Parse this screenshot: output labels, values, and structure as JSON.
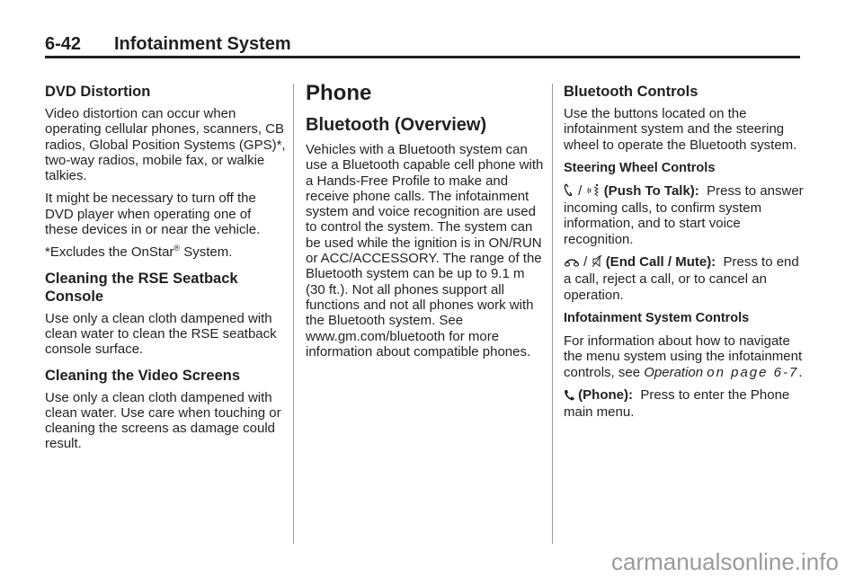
{
  "header": {
    "page_number": "6-42",
    "title": "Infotainment System"
  },
  "col1": {
    "dvd_heading": "DVD Distortion",
    "dvd_p1": "Video distortion can occur when operating cellular phones, scanners, CB radios, Global Position Systems (GPS)*, two-way radios, mobile fax, or walkie talkies.",
    "dvd_p2": "It might be necessary to turn off the DVD player when operating one of these devices in or near the vehicle.",
    "excl_prefix": "*Excludes the OnStar",
    "excl_reg": "®",
    "excl_suffix": " System.",
    "rse_heading": "Cleaning the RSE Seatback Console",
    "rse_p": "Use only a clean cloth dampened with clean water to clean the RSE seatback console surface.",
    "video_heading": "Cleaning the Video Screens",
    "video_p": "Use only a clean cloth dampened with clean water. Use care when touching or cleaning the screens as damage could result."
  },
  "col2": {
    "phone_heading": "Phone",
    "bt_heading": "Bluetooth (Overview)",
    "bt_p": "Vehicles with a Bluetooth system can use a Bluetooth capable cell phone with a Hands-Free Profile to make and receive phone calls. The infotainment system and voice recognition are used to control the system. The system can be used while the ignition is in ON/RUN or ACC/ACCESSORY. The range of the Bluetooth system can be up to 9.1 m (30 ft.). Not all phones support all functions and not all phones work with the Bluetooth system. See www.gm.com/bluetooth for more information about compatible phones."
  },
  "col3": {
    "btc_heading": "Bluetooth Controls",
    "btc_p": "Use the buttons located on the infotainment system and the steering wheel to operate the Bluetooth system.",
    "swc_heading": "Steering Wheel Controls",
    "ptt_sep": " / ",
    "ptt_label": "(Push To Talk):",
    "ptt_text": "  Press to answer incoming calls, to confirm system information, and to start voice recognition.",
    "end_sep": " / ",
    "end_label": "(End Call / Mute):",
    "end_text": "  Press to end a call, reject a call, or to cancel an operation.",
    "isc_heading": "Infotainment System Controls",
    "isc_p": "For information about how to navigate the menu system using the infotainment controls, see ",
    "isc_ref": "Operation",
    "isc_ref2": "on page 6-7",
    "isc_end": ".",
    "phone_label": "(Phone):",
    "phone_text": "  Press to enter the Phone main menu."
  },
  "icons": [
    "phone-handset-icon",
    "voice-recognition-icon",
    "end-call-icon",
    "mute-icon",
    "phone-icon"
  ],
  "watermark": "carmanualsonline.info"
}
